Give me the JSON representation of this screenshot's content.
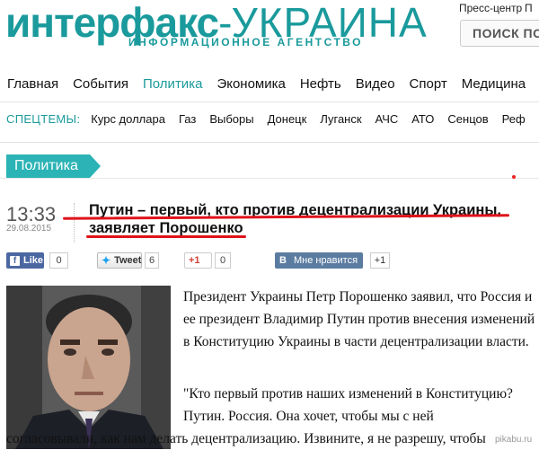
{
  "header": {
    "logo_main": "интерфакс",
    "logo_dash": "-",
    "logo_region": "УКРАИНА",
    "logo_subtitle": "ИНФОРМАЦИОННОЕ АГЕНТСТВО",
    "press_center": "Пресс-центр",
    "press_center_cut": "П",
    "search_label": "ПОИСК ПО"
  },
  "main_nav": [
    {
      "label": "Главная",
      "active": false
    },
    {
      "label": "События",
      "active": false
    },
    {
      "label": "Политика",
      "active": true
    },
    {
      "label": "Экономика",
      "active": false
    },
    {
      "label": "Нефть",
      "active": false
    },
    {
      "label": "Видео",
      "active": false
    },
    {
      "label": "Спорт",
      "active": false
    },
    {
      "label": "Медицина",
      "active": false
    }
  ],
  "special_topics": {
    "label": "СПЕЦТЕМЫ:",
    "items": [
      "Курс доллара",
      "Газ",
      "Выборы",
      "Донецк",
      "Луганск",
      "АЧС",
      "АТО",
      "Сенцов",
      "Реф"
    ]
  },
  "section_tag": "Политика",
  "article": {
    "time": "13:33",
    "date": "29.08.2015",
    "title": "Путин – первый, кто против децентрализации Украины, заявляет Порошенко",
    "paragraph1": "Президент Украины Петр Порошенко заявил, что Россия и ее президент Владимир Путин против внесения изменений в Конституцию Украины в части децентрализации власти.",
    "quote_line1": "\"Кто первый против наших изменений в Конституцию?",
    "quote_line2": "Путин. Россия. Она хочет, чтобы мы с ней",
    "quote_line3": "согласовывали, как нам делать децентрализацию. Извините, я не разрешу, чтобы"
  },
  "share": {
    "facebook_label": "Like",
    "facebook_icon_letter": "f",
    "facebook_count": "0",
    "twitter_label": "Tweet",
    "twitter_count": "6",
    "gplus_label": "+1",
    "gplus_count": "0",
    "vk_letter": "В",
    "vk_label": "Мне нравится",
    "vk_count": "+1"
  },
  "watermark": "pikabu.ru",
  "colors": {
    "brand": "#1a9a9c",
    "tag_bg": "#2bb3b5",
    "underline": "#e0131b",
    "facebook": "#4b67a1",
    "vk": "#5b7ca1"
  }
}
